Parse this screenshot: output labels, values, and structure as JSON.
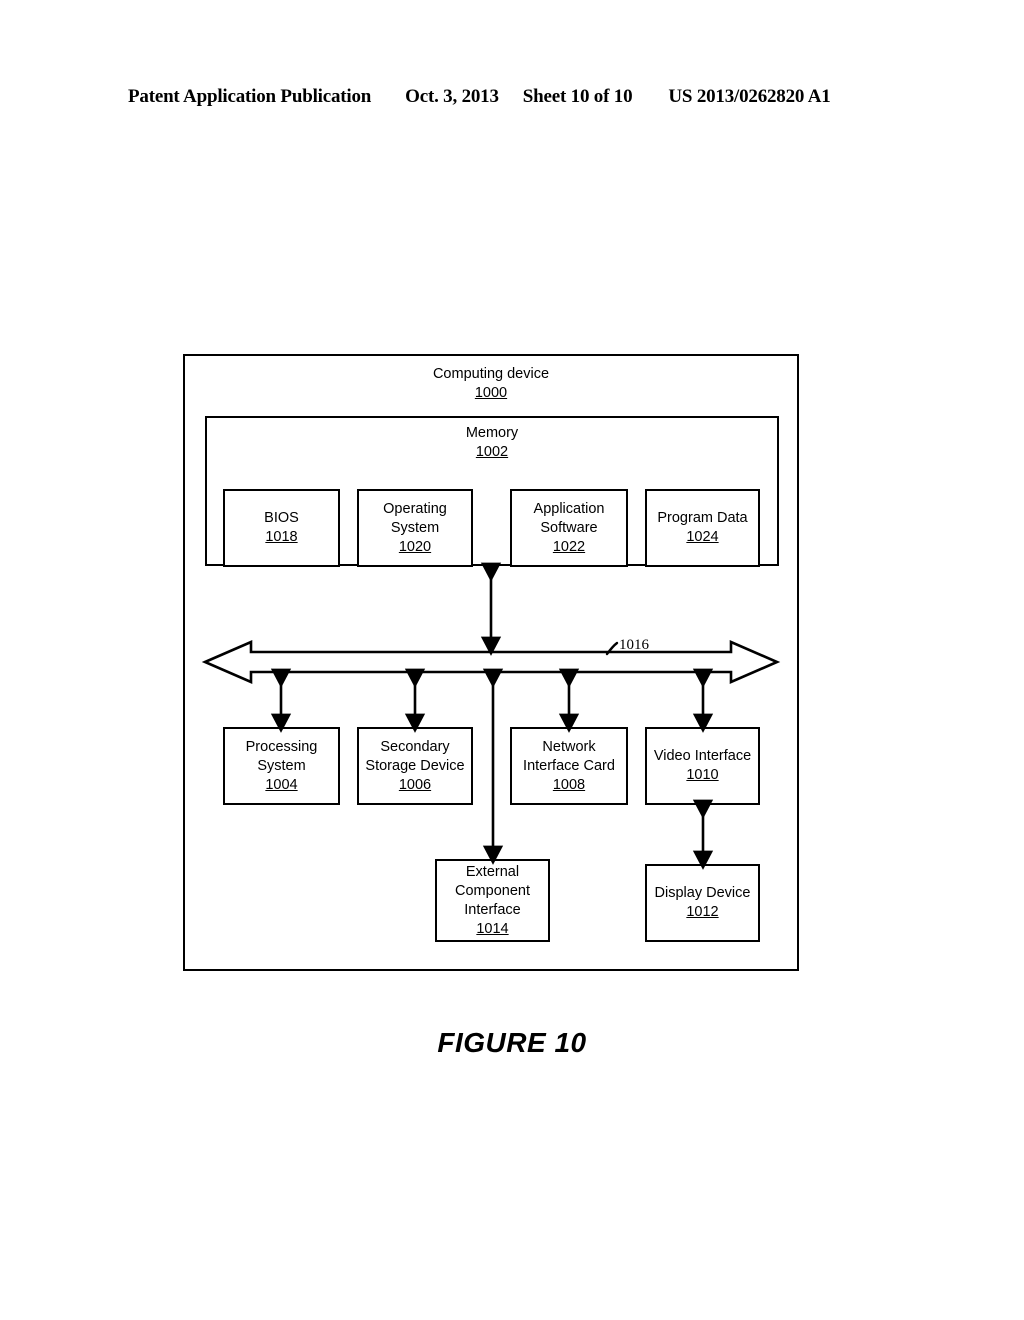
{
  "header": {
    "publication": "Patent Application Publication",
    "date": "Oct. 3, 2013",
    "sheet": "Sheet 10 of 10",
    "patent_number": "US 2013/0262820 A1"
  },
  "figure": {
    "caption": "FIGURE 10"
  },
  "diagram": {
    "outer": {
      "title": "Computing device",
      "ref": "1000"
    },
    "memory": {
      "title": "Memory",
      "ref": "1002",
      "components": [
        {
          "lines": [
            "BIOS"
          ],
          "ref": "1018"
        },
        {
          "lines": [
            "Operating",
            "System"
          ],
          "ref": "1020"
        },
        {
          "lines": [
            "Application",
            "Software"
          ],
          "ref": "1022"
        },
        {
          "lines": [
            "Program Data"
          ],
          "ref": "1024"
        }
      ]
    },
    "bus": {
      "ref": "1016"
    },
    "devices": [
      {
        "lines": [
          "Processing",
          "System"
        ],
        "ref": "1004"
      },
      {
        "lines": [
          "Secondary",
          "Storage Device"
        ],
        "ref": "1006"
      },
      {
        "lines": [
          "Network",
          "Interface Card"
        ],
        "ref": "1008"
      },
      {
        "lines": [
          "Video Interface"
        ],
        "ref": "1010"
      }
    ],
    "peripherals": [
      {
        "lines": [
          "External",
          "Component",
          "Interface"
        ],
        "ref": "1014"
      },
      {
        "lines": [
          "Display Device"
        ],
        "ref": "1012"
      }
    ]
  }
}
